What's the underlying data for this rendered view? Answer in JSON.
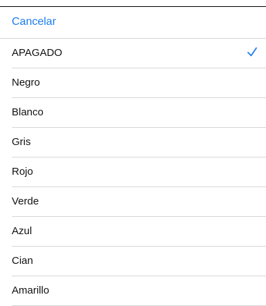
{
  "header": {
    "cancel_label": "Cancelar"
  },
  "options": [
    {
      "label": "APAGADO",
      "selected": true
    },
    {
      "label": "Negro",
      "selected": false
    },
    {
      "label": "Blanco",
      "selected": false
    },
    {
      "label": "Gris",
      "selected": false
    },
    {
      "label": "Rojo",
      "selected": false
    },
    {
      "label": "Verde",
      "selected": false
    },
    {
      "label": "Azul",
      "selected": false
    },
    {
      "label": "Cian",
      "selected": false
    },
    {
      "label": "Amarillo",
      "selected": false
    }
  ],
  "colors": {
    "accent": "#1a7cf0",
    "text": "#111111",
    "divider": "#d6d6da"
  },
  "icons": {
    "selected_marker": "checkmark-icon"
  }
}
